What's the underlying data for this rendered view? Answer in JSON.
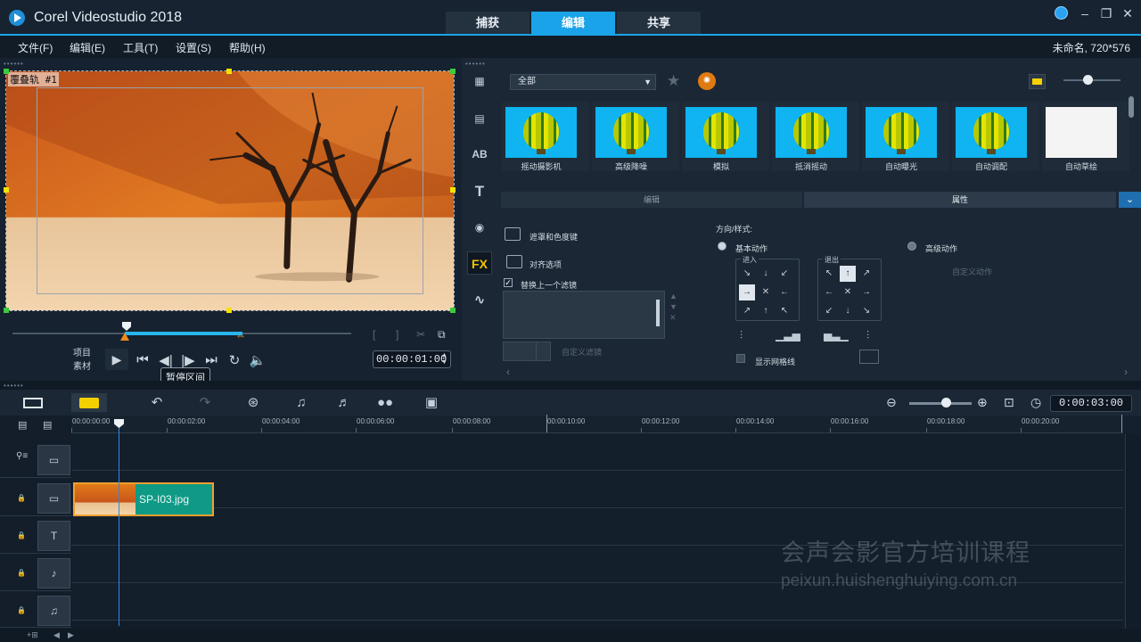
{
  "window": {
    "title": "Corel Videostudio 2018",
    "controls": [
      "–",
      "❐",
      "✕"
    ]
  },
  "mode_tabs": [
    {
      "label": "捕获",
      "active": false
    },
    {
      "label": "编辑",
      "active": true
    },
    {
      "label": "共享",
      "active": false
    }
  ],
  "menu": {
    "items": [
      "文件(F)",
      "编辑(E)",
      "工具(T)",
      "设置(S)",
      "帮助(H)"
    ],
    "project_info": "未命名, 720*576"
  },
  "preview": {
    "track_tag": "覆叠轨 #1",
    "controls_label_project": "项目",
    "controls_label_clip": "素材",
    "tooltip": "暂停区间",
    "timecode": "00:00:01:00"
  },
  "library": {
    "category": "全部",
    "effects": [
      "摇动摄影机",
      "高级降噪",
      "模拟",
      "抵消摇动",
      "自动曝光",
      "自动调配",
      "自动草绘"
    ],
    "panel_tabs": [
      {
        "label": "编辑",
        "active": false
      },
      {
        "label": "属性",
        "active": true
      }
    ],
    "options": {
      "mask_chroma": "遮罩和色度键",
      "align": "对齐选项",
      "replace_filter": "替换上一个滤镜",
      "custom_filter": "自定义滤镜"
    },
    "motion": {
      "heading": "方向/样式:",
      "basic": "基本动作",
      "advanced": "高级动作",
      "custom": "自定义动作",
      "enter": "进入",
      "exit": "退出",
      "show_grid": "显示网格线"
    }
  },
  "timeline": {
    "timecode": "0:00:03:00",
    "ruler": [
      "00:00:00:00",
      "00:00:02:00",
      "00:00:04:00",
      "00:00:06:00",
      "00:00:08:00",
      "00:00:10:00",
      "00:00:12:00",
      "00:00:14:00",
      "00:00:16:00",
      "00:00:18:00",
      "00:00:20:00"
    ],
    "clip_name": "SP-I03.jpg"
  },
  "watermark": {
    "title": "会声会影官方培训课程",
    "url": "peixun.huishenghuiying.com.cn"
  },
  "colors": {
    "accent": "#1aa3e8",
    "clip": "#0f9a86",
    "highlight": "#f4d000"
  }
}
